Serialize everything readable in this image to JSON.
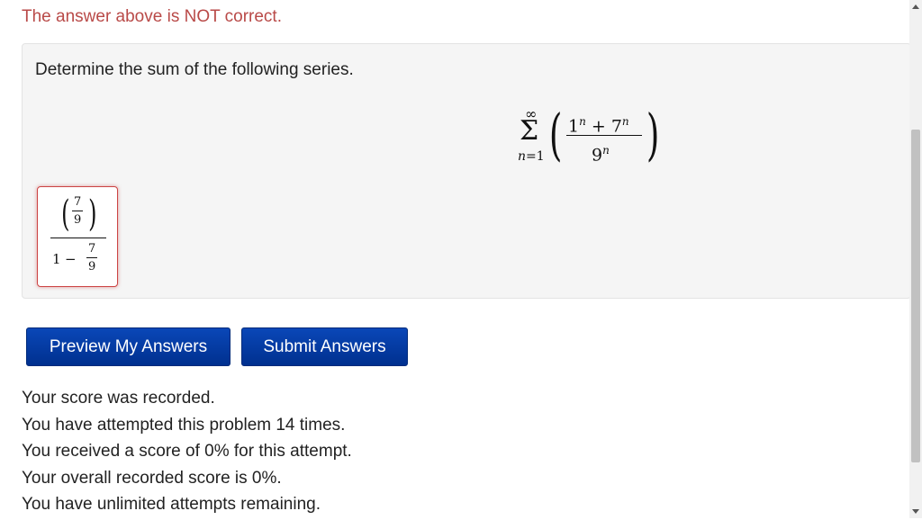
{
  "feedback": {
    "message": "The answer above is NOT correct."
  },
  "problem": {
    "prompt": "Determine the sum of the following series.",
    "series": {
      "upper": "∞",
      "lower_var": "n",
      "lower_eq": "=1",
      "num_a": "1",
      "num_plus": " + ",
      "num_b": "7",
      "exp": "n",
      "den": "9"
    }
  },
  "answer": {
    "top_num": "7",
    "top_den": "9",
    "one": "1",
    "minus": "−",
    "bot_num": "7",
    "bot_den": "9"
  },
  "buttons": {
    "preview_label": "Preview My Answers",
    "submit_label": "Submit Answers"
  },
  "score": {
    "line1": "Your score was recorded.",
    "line2": "You have attempted this problem 14 times.",
    "line3": "You received a score of 0% for this attempt.",
    "line4": "Your overall recorded score is 0%.",
    "line5": "You have unlimited attempts remaining."
  }
}
